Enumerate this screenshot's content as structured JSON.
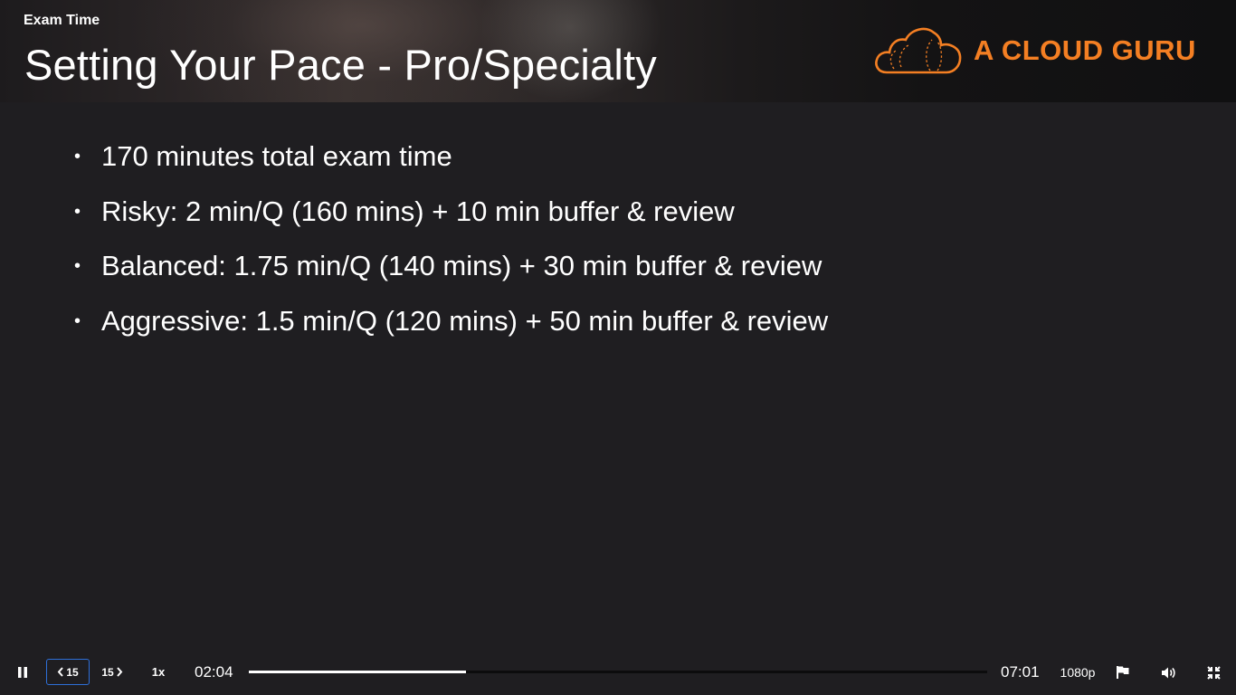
{
  "lesson": {
    "title": "Exam Time"
  },
  "slide": {
    "title": "Setting Your Pace - Pro/Specialty",
    "bullets": [
      "170 minutes total exam time",
      "Risky: 2 min/Q (160 mins) + 10 min buffer & review",
      "Balanced: 1.75 min/Q (140 mins) + 30 min buffer & review",
      "Aggressive: 1.5 min/Q (120 mins) + 50 min buffer & review"
    ],
    "bullet_symbol": "•"
  },
  "brand": {
    "logo_text": "A CLOUD GURU",
    "logo_icon": "cloud-logo-icon",
    "accent_color": "#f47f23"
  },
  "player": {
    "pause_icon": "pause-icon",
    "rewind_label": "15",
    "forward_label": "15",
    "speed_label": "1x",
    "current_time": "02:04",
    "total_time": "07:01",
    "progress_fraction": 0.294,
    "quality_label": "1080p",
    "flag_icon": "flag-icon",
    "volume_icon": "volume-icon",
    "fullscreen_icon": "exit-fullscreen-icon",
    "focus_color": "#2e6fd8"
  }
}
